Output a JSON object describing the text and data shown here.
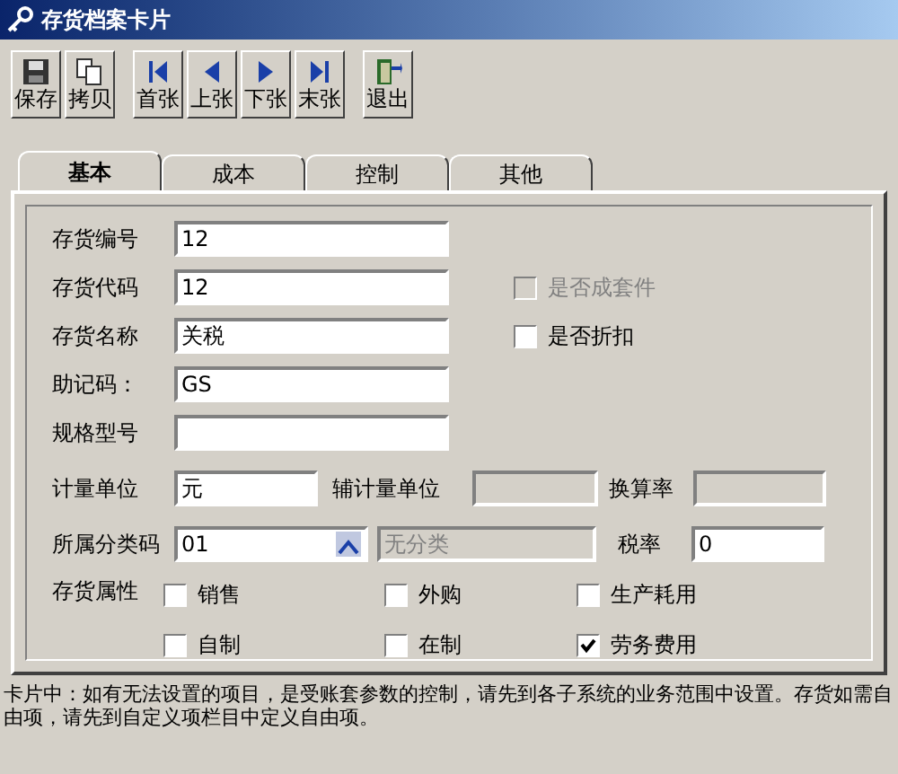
{
  "window": {
    "title": "存货档案卡片"
  },
  "toolbar": [
    {
      "buttons": [
        {
          "label": "保存",
          "kind": "save"
        },
        {
          "label": "拷贝",
          "kind": "copy"
        }
      ]
    },
    {
      "buttons": [
        {
          "label": "首张",
          "kind": "first"
        },
        {
          "label": "上张",
          "kind": "prev"
        },
        {
          "label": "下张",
          "kind": "next"
        },
        {
          "label": "末张",
          "kind": "last"
        }
      ]
    },
    {
      "buttons": [
        {
          "label": "退出",
          "kind": "exit"
        }
      ]
    }
  ],
  "tabs": [
    {
      "label": "基本",
      "selected": true
    },
    {
      "label": "成本",
      "selected": false
    },
    {
      "label": "控制",
      "selected": false
    },
    {
      "label": "其他",
      "selected": false
    }
  ],
  "fields": [
    {
      "label": "存货编号",
      "value": "12"
    },
    {
      "label": "存货代码",
      "value": "12",
      "option": {
        "label": "是否成套件",
        "checked": false,
        "disabled": true
      }
    },
    {
      "label": "存货名称",
      "value": "关税",
      "option": {
        "label": "是否折扣",
        "checked": false,
        "disabled": false
      }
    },
    {
      "label": "助记码：",
      "value": "GS"
    },
    {
      "label": "规格型号"
    }
  ],
  "units": {
    "unit": {
      "label": "计量单位",
      "value": "元",
      "disabled": false
    },
    "aux_unit": {
      "label": "辅计量单位",
      "disabled": true
    },
    "rate": {
      "label": "换算率",
      "disabled": true
    }
  },
  "category": {
    "label": "所属分类码",
    "code": "01",
    "name": "无分类",
    "tax_label": "税率",
    "tax_value": "0"
  },
  "attributes": {
    "label": "存货属性",
    "options": [
      {
        "label": "销售",
        "checked": false
      },
      {
        "label": "外购",
        "checked": false
      },
      {
        "label": "生产耗用",
        "checked": false
      },
      {
        "label": "自制",
        "checked": false
      },
      {
        "label": "在制",
        "checked": false
      },
      {
        "label": "劳务费用",
        "checked": true
      }
    ]
  },
  "note": "卡片中：如有无法设置的项目，是受账套参数的控制，请先到各子系统的业务范围中设置。存货如需自由项，请先到自定义项栏目中定义自由项。"
}
